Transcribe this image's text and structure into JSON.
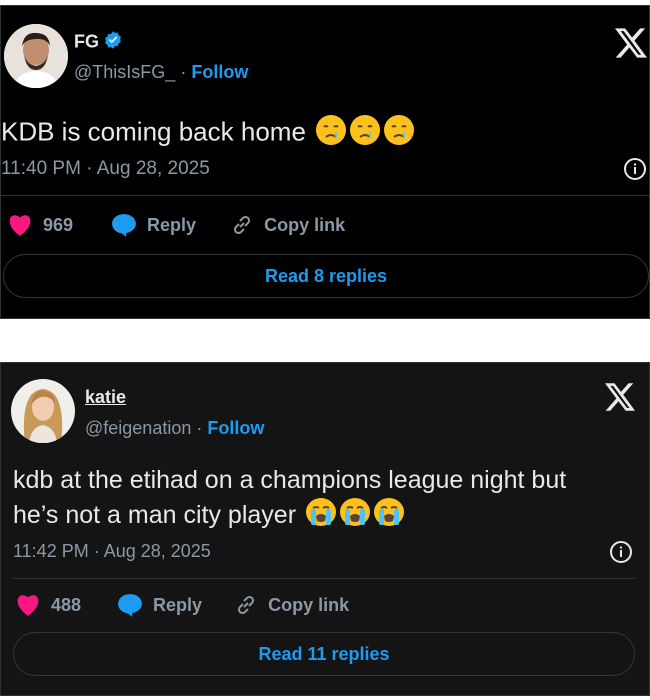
{
  "tweets": [
    {
      "name": "FG",
      "verified": true,
      "handle": "@ThisIsFG_",
      "separator": "·",
      "follow": "Follow",
      "text": "KDB is coming back home",
      "emojis": [
        "crying-face",
        "crying-face",
        "crying-face"
      ],
      "time": "11:40 PM · Aug 28, 2025",
      "likes": "969",
      "reply": "Reply",
      "copy_link": "Copy link",
      "read_replies": "Read 8 replies"
    },
    {
      "name": "katie",
      "verified": false,
      "handle": "@feigenation",
      "separator": "·",
      "follow": "Follow",
      "text_line1": "kdb at the etihad on a champions league night but",
      "text_line2": "he’s not a man city player",
      "emojis": [
        "loudly-crying-face",
        "loudly-crying-face",
        "loudly-crying-face"
      ],
      "time": "11:42 PM · Aug 28, 2025",
      "likes": "488",
      "reply": "Reply",
      "copy_link": "Copy link",
      "read_replies": "Read 11 replies"
    }
  ],
  "colors": {
    "accent": "#1d9bf0",
    "like": "#f91880",
    "muted": "#8b98a5",
    "text": "#e7e9ea"
  }
}
